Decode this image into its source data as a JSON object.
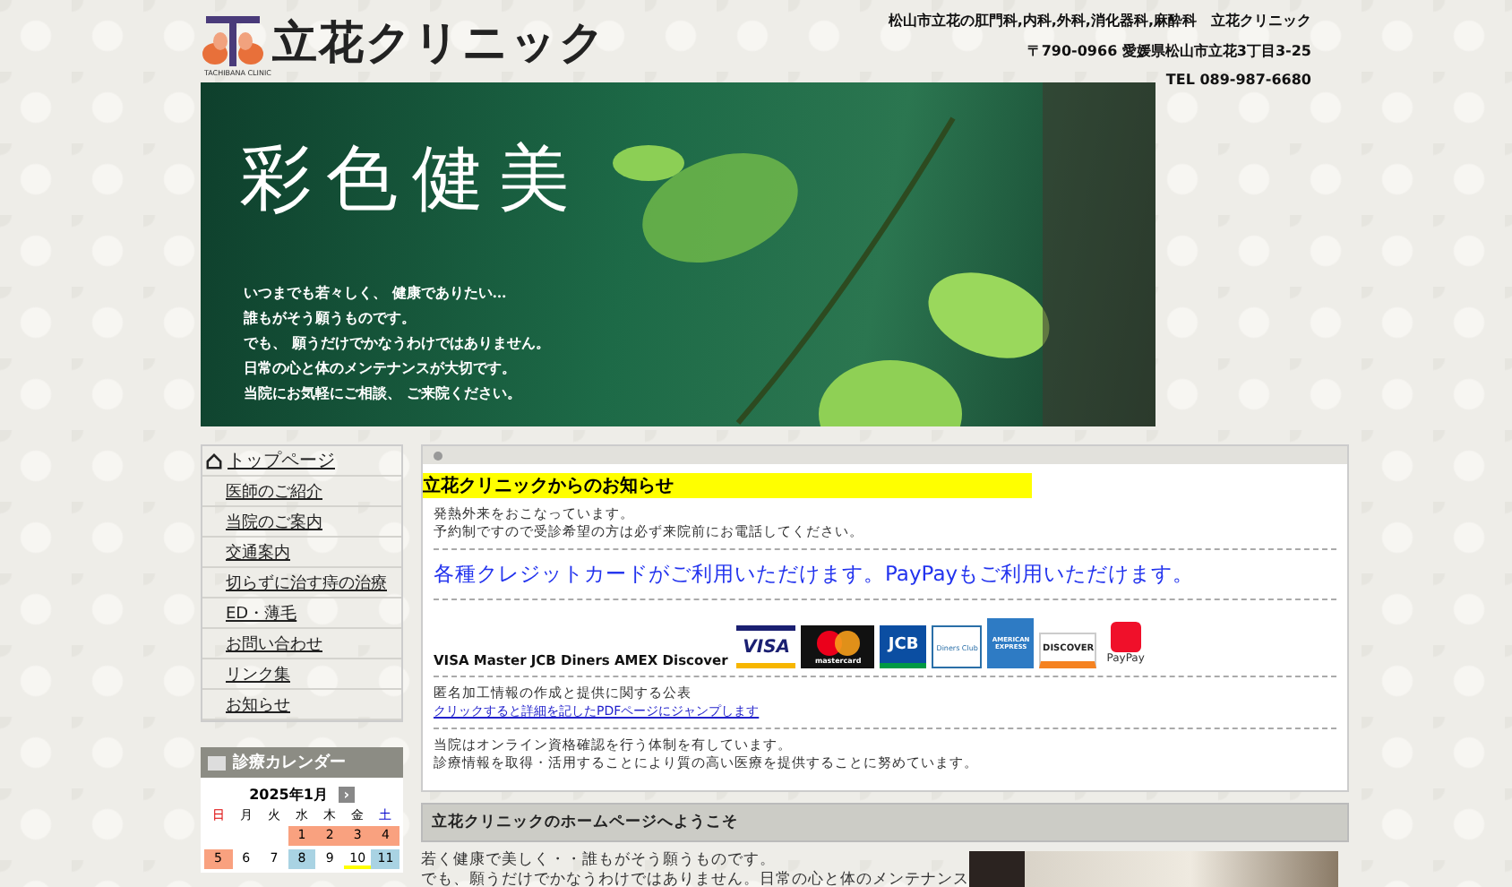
{
  "header": {
    "logo_text": "立花クリニック",
    "logo_sub": "TACHIBANA CLINIC",
    "tagline": "松山市立花の肛門科,内科,外科,消化器科,麻酔科　立花クリニック",
    "address": "〒790-0966 愛媛県松山市立花3丁目3-25",
    "phone": "TEL 089-987-6680"
  },
  "banner": {
    "title": "彩色健美",
    "lines": [
      "いつまでも若々しく、 健康でありたい…",
      "誰もがそう願うものです。",
      "でも、 願うだけでかなうわけではありません。",
      "日常の心と体のメンテナンスが大切です。",
      "当院にお気軽にご相談、 ご来院ください。"
    ]
  },
  "sidebar": {
    "items": [
      {
        "label": "トップページ",
        "kind": "home"
      },
      {
        "label": "医師のご紹介",
        "kind": "link"
      },
      {
        "label": "当院のご案内",
        "kind": "link"
      },
      {
        "label": "交通案内",
        "kind": "link"
      },
      {
        "label": "切らずに治す痔の治療",
        "kind": "link"
      },
      {
        "label": "ED・薄毛",
        "kind": "link"
      },
      {
        "label": "お問い合わせ",
        "kind": "link"
      },
      {
        "label": "リンク集",
        "kind": "link"
      },
      {
        "label": "お知らせ",
        "kind": "link"
      }
    ]
  },
  "calendar": {
    "title": "診療カレンダー",
    "month": "2025年1月",
    "next": "›",
    "weekdays": [
      {
        "label": "日",
        "kind": "sunday"
      },
      {
        "label": "月",
        "kind": "weekday"
      },
      {
        "label": "火",
        "kind": "weekday"
      },
      {
        "label": "水",
        "kind": "weekday"
      },
      {
        "label": "木",
        "kind": "weekday"
      },
      {
        "label": "金",
        "kind": "weekday"
      },
      {
        "label": "土",
        "kind": "saturday"
      }
    ],
    "weeks": [
      [
        {
          "kind": "empty"
        },
        {
          "kind": "empty"
        },
        {
          "kind": "empty"
        },
        {
          "day": "1",
          "kind": "closed",
          "today": false
        },
        {
          "day": "2",
          "kind": "closed",
          "today": false
        },
        {
          "day": "3",
          "kind": "closed",
          "today": false
        },
        {
          "day": "4",
          "kind": "closed",
          "today": false
        }
      ],
      [
        {
          "day": "5",
          "kind": "closed",
          "today": false
        },
        {
          "day": "6",
          "kind": "open",
          "today": false
        },
        {
          "day": "7",
          "kind": "open",
          "today": false
        },
        {
          "day": "8",
          "kind": "half",
          "today": false
        },
        {
          "day": "9",
          "kind": "open",
          "today": false
        },
        {
          "day": "10",
          "kind": "open",
          "today": true
        },
        {
          "day": "11",
          "kind": "half",
          "today": false
        }
      ]
    ]
  },
  "notice": {
    "title": "立花クリニックからのお知らせ",
    "blocks": [
      {
        "kind": "text",
        "lines": [
          "発熱外来をおこなっています。",
          "予約制ですので受診希望の方は必ず来院前にお電話してください。"
        ]
      },
      {
        "kind": "headline",
        "text": "各種クレジットカードがご利用いただけます。PayPayもご利用いただけます。"
      },
      {
        "kind": "cards",
        "text": "VISA Master JCB Diners AMEX Discover",
        "cards": [
          {
            "label": "VISA",
            "kind": "visa"
          },
          {
            "label": "mastercard",
            "kind": "master"
          },
          {
            "label": "JCB",
            "kind": "jcb"
          },
          {
            "label": "Diners Club",
            "kind": "diners"
          },
          {
            "label": "AMERICAN EXPRESS",
            "kind": "amex"
          },
          {
            "label": "DISCOVER",
            "kind": "discover"
          },
          {
            "label": "PayPay",
            "kind": "paypay"
          }
        ]
      },
      {
        "kind": "link",
        "text": "匿名加工情報の作成と提供に関する公表",
        "link": "クリックすると詳細を記したPDFページにジャンプします"
      },
      {
        "kind": "text",
        "lines": [
          "当院はオンライン資格確認を行う体制を有しています。",
          "診療情報を取得・活用することにより質の高い医療を提供することに努めています。"
        ]
      }
    ]
  },
  "welcome": {
    "title": "立花クリニックのホームページへようこそ",
    "lines": [
      "若く健康で美しく・・誰もがそう願うものです。",
      "でも、願うだけでかなうわけではありません。日常の心と体のメンテナンス"
    ]
  }
}
